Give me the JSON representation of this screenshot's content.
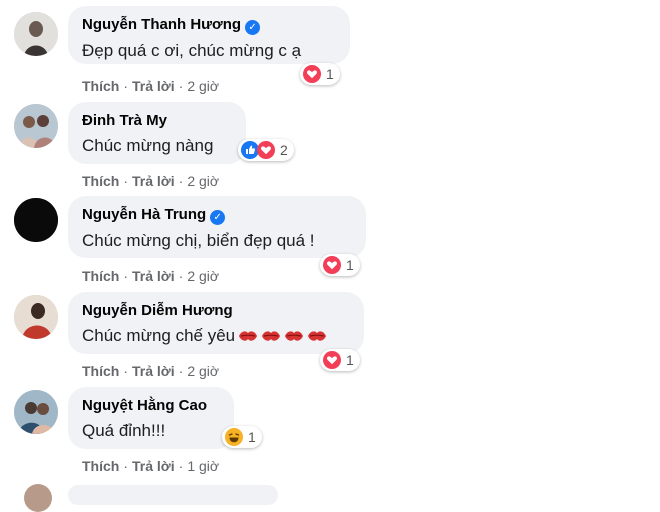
{
  "comments": [
    {
      "author": "Nguyễn Thanh Hương",
      "verified": true,
      "text": "Đẹp quá c ơi, chúc mừng c ạ",
      "reactions": {
        "types": [
          "love"
        ],
        "count": "1"
      },
      "actions": {
        "like": "Thích",
        "reply": "Trả lời",
        "time": "2 giờ"
      }
    },
    {
      "author": "Đinh Trà My",
      "verified": false,
      "text": "Chúc mừng nàng",
      "reactions": {
        "types": [
          "like",
          "love"
        ],
        "count": "2"
      },
      "actions": {
        "like": "Thích",
        "reply": "Trả lời",
        "time": "2 giờ"
      }
    },
    {
      "author": "Nguyễn Hà Trung",
      "verified": true,
      "text": "Chúc mừng chị, biển đẹp quá !",
      "reactions": {
        "types": [
          "love"
        ],
        "count": "1"
      },
      "actions": {
        "like": "Thích",
        "reply": "Trả lời",
        "time": "2 giờ"
      }
    },
    {
      "author": "Nguyễn Diễm Hương",
      "verified": false,
      "text": "Chúc mừng chế yêu",
      "inline_emoji": [
        "kiss-icon",
        "kiss-icon",
        "kiss-icon",
        "kiss-icon"
      ],
      "reactions": {
        "types": [
          "love"
        ],
        "count": "1"
      },
      "actions": {
        "like": "Thích",
        "reply": "Trả lời",
        "time": "2 giờ"
      }
    },
    {
      "author": "Nguyệt Hằng Cao",
      "verified": false,
      "text": "Quá đỉnh!!!",
      "reactions": {
        "types": [
          "haha"
        ],
        "count": "1"
      },
      "actions": {
        "like": "Thích",
        "reply": "Trả lời",
        "time": "1 giờ"
      }
    }
  ],
  "colors": {
    "bubble": "#f0f2f5",
    "meta_text": "#65676b",
    "verified": "#1877f2",
    "love": "#f33e58",
    "like": "#1877f2",
    "haha": "#f7b125"
  }
}
